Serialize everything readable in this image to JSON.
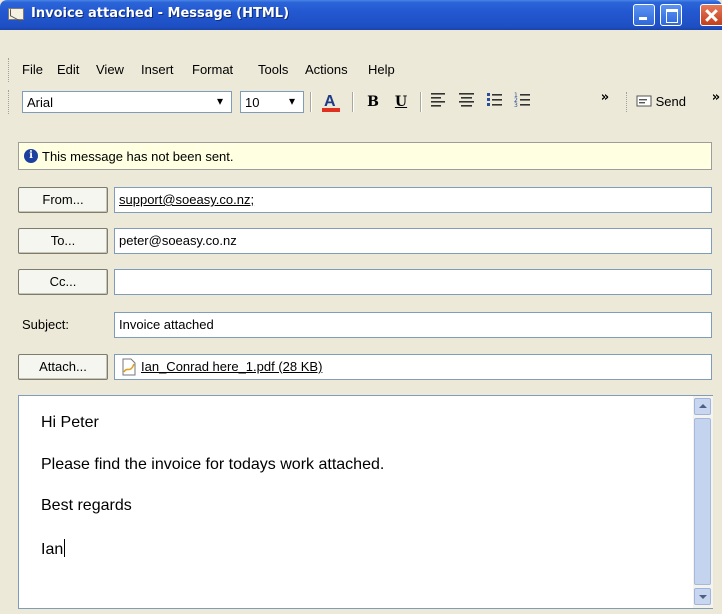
{
  "window": {
    "title": "Invoice attached - Message (HTML)",
    "icon": "envelope-icon"
  },
  "menu": [
    "File",
    "Edit",
    "View",
    "Insert",
    "Format",
    "Tools",
    "Actions",
    "Help"
  ],
  "format_toolbar": {
    "font": "Arial",
    "size": "10",
    "overflow": "»",
    "send_label": "Send"
  },
  "info": {
    "message": "This message has not been sent.",
    "icon": "info-icon"
  },
  "header": {
    "from_button": "From...",
    "from_value": "support@soeasy.co.nz;",
    "to_button": "To...",
    "to_value": "peter@soeasy.co.nz",
    "cc_button": "Cc...",
    "cc_value": "",
    "subject_label": "Subject:",
    "subject_value": "Invoice attached",
    "attach_button": "Attach...",
    "attachment": "Ian_Conrad here_1.pdf (28 KB)"
  },
  "body": {
    "lines": [
      "Hi Peter",
      "Please find the invoice for todays work attached.",
      "Best regards",
      "Ian"
    ]
  },
  "colors": {
    "titlebar": "#2358d0",
    "infobar": "#ffffe1",
    "window_bg": "#ECE9D8"
  }
}
